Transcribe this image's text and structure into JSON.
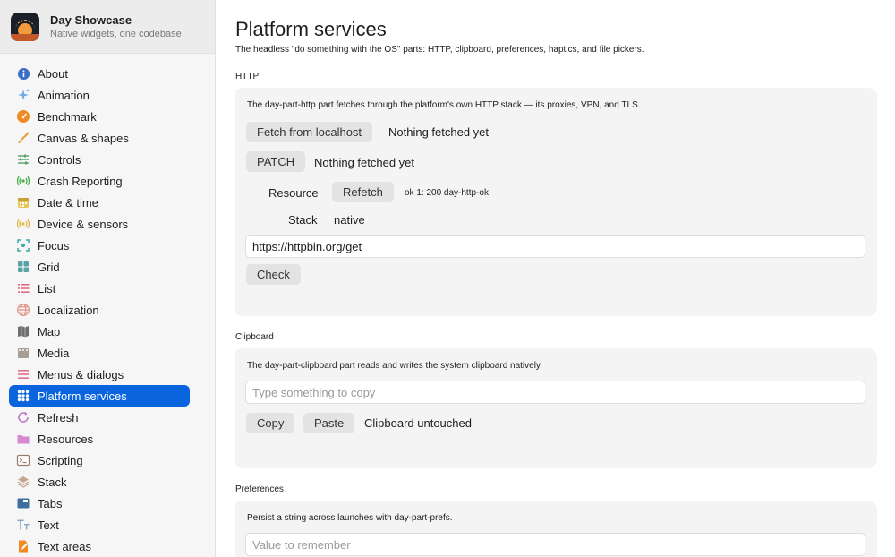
{
  "app": {
    "title": "Day Showcase",
    "subtitle": "Native widgets, one codebase"
  },
  "sidebar": {
    "items": [
      {
        "label": "About",
        "icon": "info-icon"
      },
      {
        "label": "Animation",
        "icon": "sparkles-icon"
      },
      {
        "label": "Benchmark",
        "icon": "speedometer-icon"
      },
      {
        "label": "Canvas & shapes",
        "icon": "paintbrush-icon"
      },
      {
        "label": "Controls",
        "icon": "sliders-icon"
      },
      {
        "label": "Crash Reporting",
        "icon": "broadcast-icon"
      },
      {
        "label": "Date & time",
        "icon": "calendar-icon"
      },
      {
        "label": "Device & sensors",
        "icon": "sensor-icon"
      },
      {
        "label": "Focus",
        "icon": "focus-icon"
      },
      {
        "label": "Grid",
        "icon": "grid-icon"
      },
      {
        "label": "List",
        "icon": "list-icon"
      },
      {
        "label": "Localization",
        "icon": "globe-icon"
      },
      {
        "label": "Map",
        "icon": "map-icon"
      },
      {
        "label": "Media",
        "icon": "film-icon"
      },
      {
        "label": "Menus & dialogs",
        "icon": "menu-icon"
      },
      {
        "label": "Platform services",
        "icon": "dots-grid-icon"
      },
      {
        "label": "Refresh",
        "icon": "refresh-icon"
      },
      {
        "label": "Resources",
        "icon": "folder-icon"
      },
      {
        "label": "Scripting",
        "icon": "terminal-icon"
      },
      {
        "label": "Stack",
        "icon": "stack-icon"
      },
      {
        "label": "Tabs",
        "icon": "tabs-icon"
      },
      {
        "label": "Text",
        "icon": "text-icon"
      },
      {
        "label": "Text areas",
        "icon": "text-edit-icon"
      }
    ],
    "active_index": 15
  },
  "main": {
    "title": "Platform services",
    "description": "The headless \"do something with the OS\" parts: HTTP, clipboard, preferences, haptics, and file pickers.",
    "http": {
      "label": "HTTP",
      "description": "The day-part-http part fetches through the platform's own HTTP stack — its proxies, VPN, and TLS.",
      "fetch_button": "Fetch from localhost",
      "fetch_status": "Nothing fetched yet",
      "patch_button": "PATCH",
      "patch_status": "Nothing fetched yet",
      "resource_label": "Resource",
      "refetch_button": "Refetch",
      "resource_value": "ok 1: 200 day-http-ok",
      "stack_label": "Stack",
      "stack_value": "native",
      "url_value": "https://httpbin.org/get",
      "check_button": "Check"
    },
    "clipboard": {
      "label": "Clipboard",
      "description": "The day-part-clipboard part reads and writes the system clipboard natively.",
      "input_placeholder": "Type something to copy",
      "copy_button": "Copy",
      "paste_button": "Paste",
      "status": "Clipboard untouched"
    },
    "preferences": {
      "label": "Preferences",
      "description": "Persist a string across launches with day-part-prefs.",
      "input_placeholder": "Value to remember"
    }
  },
  "colors": {
    "accent": "#0a64dd",
    "panel": "#f4f4f4",
    "sidebar": "#f6f6f6"
  }
}
